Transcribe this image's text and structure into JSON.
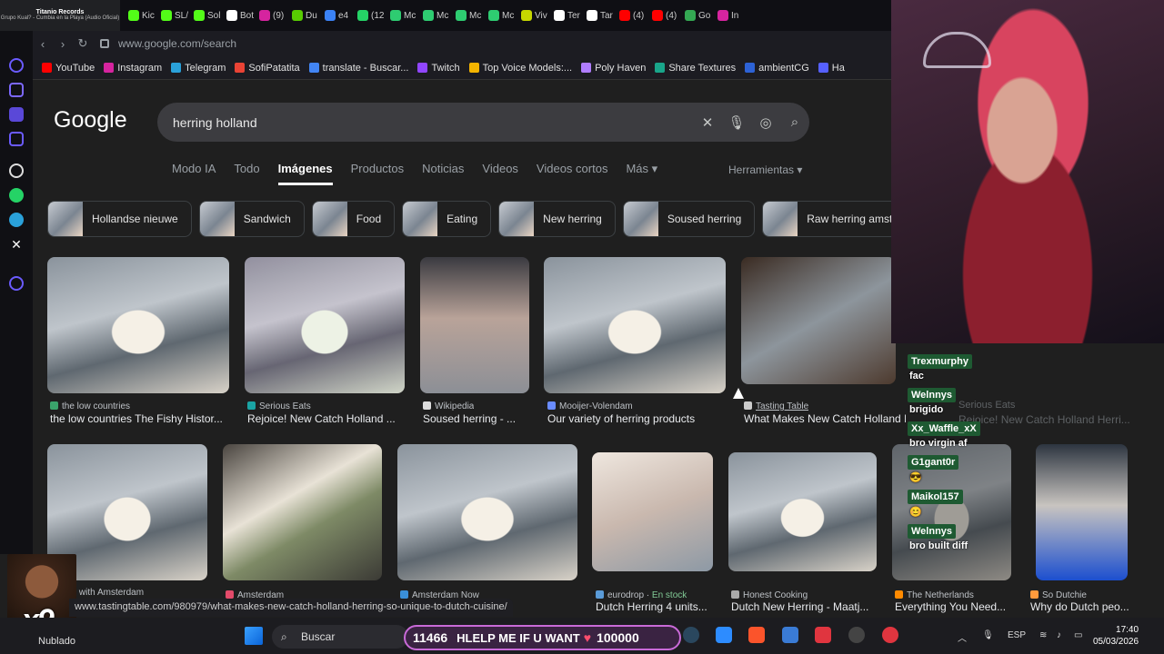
{
  "media": {
    "title": "Titanio Records",
    "subtitle": "Grupo Kual? - Cumbia en la Playa (Audio Oficial)"
  },
  "tabs": [
    {
      "label": "Kic",
      "icon": "green-app-icon",
      "color": "#53fc18"
    },
    {
      "label": "SL/",
      "icon": "kick-icon",
      "color": "#53fc18"
    },
    {
      "label": "Sol",
      "icon": "kick-icon",
      "color": "#53fc18"
    },
    {
      "label": "Bot",
      "icon": "bot-icon",
      "color": "#ffffff"
    },
    {
      "label": "(9)",
      "icon": "instagram-icon",
      "color": "#d6249f"
    },
    {
      "label": "Du",
      "icon": "duo-icon",
      "color": "#58cc02"
    },
    {
      "label": "e4",
      "icon": "e4-icon",
      "color": "#3b82f6"
    },
    {
      "label": "(12",
      "icon": "whatsapp-icon",
      "color": "#25d366"
    },
    {
      "label": "Mc",
      "icon": "gem-icon",
      "color": "#2ecc71"
    },
    {
      "label": "Mc",
      "icon": "gem-icon",
      "color": "#2ecc71"
    },
    {
      "label": "Mc",
      "icon": "gem-icon",
      "color": "#2ecc71"
    },
    {
      "label": "Mc",
      "icon": "gem-icon",
      "color": "#2ecc71"
    },
    {
      "label": "Viv",
      "icon": "td-icon",
      "color": "#c6d700"
    },
    {
      "label": "Ter",
      "icon": "clock-icon",
      "color": "#ffffff"
    },
    {
      "label": "Tar",
      "icon": "openai-icon",
      "color": "#ffffff"
    },
    {
      "label": "(4)",
      "icon": "youtube-icon",
      "color": "#ff0000"
    },
    {
      "label": "(4)",
      "icon": "youtube-icon",
      "color": "#ff0000"
    },
    {
      "label": "Go",
      "icon": "maps-icon",
      "color": "#34a853"
    },
    {
      "label": "In",
      "icon": "instagram-icon",
      "color": "#d6249f"
    }
  ],
  "address": {
    "url": "www.google.com/search"
  },
  "bookmarks": [
    {
      "label": "YouTube",
      "icon": "youtube-icon",
      "color": "#ff0000"
    },
    {
      "label": "Instagram",
      "icon": "instagram-icon",
      "color": "#d6249f"
    },
    {
      "label": "Telegram",
      "icon": "telegram-icon",
      "color": "#2aa1da"
    },
    {
      "label": "SofiPatatita",
      "icon": "gmail-icon",
      "color": "#ea4335"
    },
    {
      "label": "translate - Buscar...",
      "icon": "google-icon",
      "color": "#4285f4"
    },
    {
      "label": "Twitch",
      "icon": "twitch-icon",
      "color": "#9146ff"
    },
    {
      "label": "Top Voice Models:...",
      "icon": "rainbow-icon",
      "color": "#f4b400"
    },
    {
      "label": "Poly Haven",
      "icon": "polyhaven-icon",
      "color": "#b07dff"
    },
    {
      "label": "Share Textures",
      "icon": "sharetextures-icon",
      "color": "#19a58a"
    },
    {
      "label": "ambientCG",
      "icon": "ambientcg-icon",
      "color": "#2d62d6"
    },
    {
      "label": "Ha",
      "icon": "ha-icon",
      "color": "#5660ff"
    }
  ],
  "google": {
    "logo": "Google",
    "query": "herring holland",
    "tabs": [
      "Modo IA",
      "Todo",
      "Imágenes",
      "Productos",
      "Noticias",
      "Videos",
      "Videos cortos",
      "Más ▾"
    ],
    "active_tab": "Imágenes",
    "tools": "Herramientas ▾",
    "chips": [
      "Hollandse nieuwe",
      "Sandwich",
      "Food",
      "Eating",
      "New herring",
      "Soused herring",
      "Raw herring amste"
    ]
  },
  "results_row1": [
    {
      "source": "the low countries",
      "title": "the low countries The Fishy Histor...",
      "fav": "#3aa36b"
    },
    {
      "source": "Serious Eats",
      "title": "Rejoice! New Catch Holland ...",
      "fav": "#1aa3a3"
    },
    {
      "source": "Wikipedia",
      "title": "Soused herring - ...",
      "fav": "#dddddd"
    },
    {
      "source": "Mooijer-Volendam",
      "title": "Our variety of herring products",
      "fav": "#6a8cff"
    },
    {
      "source": "Tasting Table",
      "title": "What Makes New Catch Holland H...",
      "fav": "#cccccc"
    }
  ],
  "results_row2": [
    {
      "source": "at's up with Amsterdam",
      "title": "...",
      "fav": "#888888"
    },
    {
      "source": "Amsterdam",
      "title": "",
      "fav": "#e34b6a"
    },
    {
      "source": "Amsterdam Now",
      "title": "",
      "fav": "#3a8fd8"
    },
    {
      "source": "eurodrop",
      "stock": "En stock",
      "title": "Dutch Herring 4 units...",
      "fav": "#5a9bd8"
    },
    {
      "source": "Honest Cooking",
      "title": "Dutch New Herring - Maatj...",
      "fav": "#aaaaaa"
    },
    {
      "source": "The Netherlands",
      "title": "Everything You Need...",
      "fav": "#ff8a00"
    },
    {
      "source": "So Dutchie",
      "title": "Why do Dutch peo...",
      "fav": "#ff9a3c"
    }
  ],
  "ghost": {
    "source": "Serious Eats",
    "title": "Rejoice! New Catch Holland Herri..."
  },
  "chat": [
    {
      "user": "Trexmurphy",
      "msg": "fac"
    },
    {
      "user": "Welnnys",
      "msg": "brigido"
    },
    {
      "user": "Xx_Waffle_xX",
      "msg": "bro virgin af"
    },
    {
      "user": "G1gant0r",
      "msg": "😎"
    },
    {
      "user": "Maikol157",
      "msg": "😊"
    },
    {
      "user": "Welnnys",
      "msg": "bro built diff"
    }
  ],
  "statusbar": {
    "url": "www.tastingtable.com/980979/what-makes-new-catch-holland-herring-so-unique-to-dutch-cuisine/"
  },
  "overlay": {
    "multiplier": "x9"
  },
  "taskbar": {
    "weather": "Nublado",
    "search": "Buscar",
    "banner_left": "11466",
    "banner_msg": "HLELP ME IF U WANT",
    "banner_right": "100000",
    "lang": "ESP",
    "time": "17:40",
    "date": "05/03/2026"
  }
}
